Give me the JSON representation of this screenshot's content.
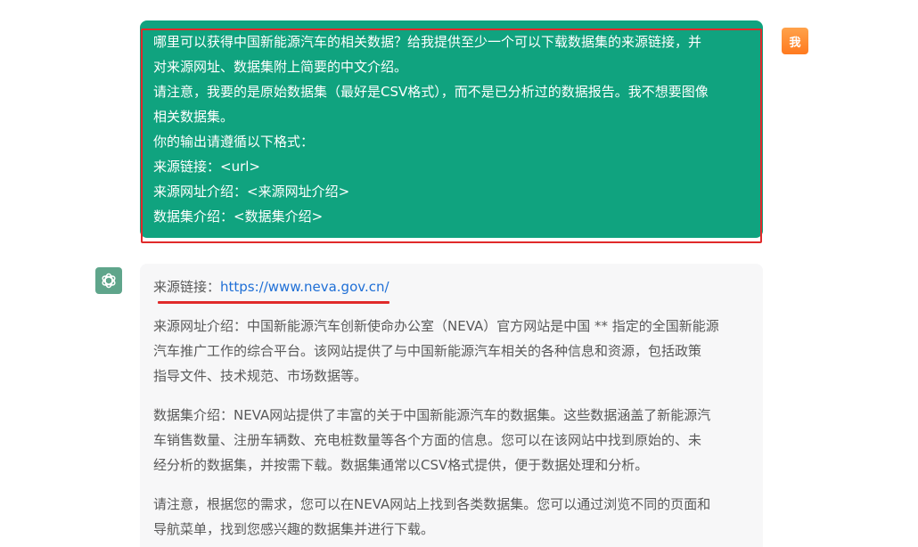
{
  "user_message": {
    "avatar_label": "我",
    "lines": [
      "哪里可以获得中国新能源汽车的相关数据？给我提供至少一个可以下载数据集的来源链接，并",
      "对来源网址、数据集附上简要的中文介绍。",
      "请注意，我要的是原始数据集（最好是CSV格式），而不是已分析过的数据报告。我不想要图像",
      "相关数据集。",
      "你的输出请遵循以下格式：",
      "来源链接：<url>",
      "来源网址介绍：<来源网址介绍>",
      "数据集介绍：<数据集介绍>"
    ],
    "bubble_color": "#10a37f"
  },
  "assistant_message": {
    "avatar_icon": "openai-logo-icon",
    "source_link_label": "来源链接：",
    "source_link_url": "https://www.neva.gov.cn/",
    "site_intro_lines": [
      "来源网址介绍：中国新能源汽车创新使命办公室（NEVA）官方网站是中国 ** 指定的全国新能源",
      "汽车推广工作的综合平台。该网站提供了与中国新能源汽车相关的各种信息和资源，包括政策",
      "指导文件、技术规范、市场数据等。"
    ],
    "dataset_intro_lines": [
      "数据集介绍：NEVA网站提供了丰富的关于中国新能源汽车的数据集。这些数据涵盖了新能源汽",
      "车销售数量、注册车辆数、充电桩数量等各个方面的信息。您可以在该网站中找到原始的、未",
      "经分析的数据集，并按需下载。数据集通常以CSV格式提供，便于数据处理和分析。"
    ],
    "note_lines": [
      "请注意，根据您的需求，您可以在NEVA网站上找到各类数据集。您可以通过浏览不同的页面和",
      "导航菜单，找到您感兴趣的数据集并进行下载。"
    ]
  },
  "colors": {
    "user_bubble": "#10a37f",
    "highlight": "#e02a2a",
    "link": "#1f6fd6",
    "assistant_bubble": "#f7f7f8",
    "assistant_avatar": "#5fa58b",
    "user_avatar": "#ff8a2a"
  }
}
